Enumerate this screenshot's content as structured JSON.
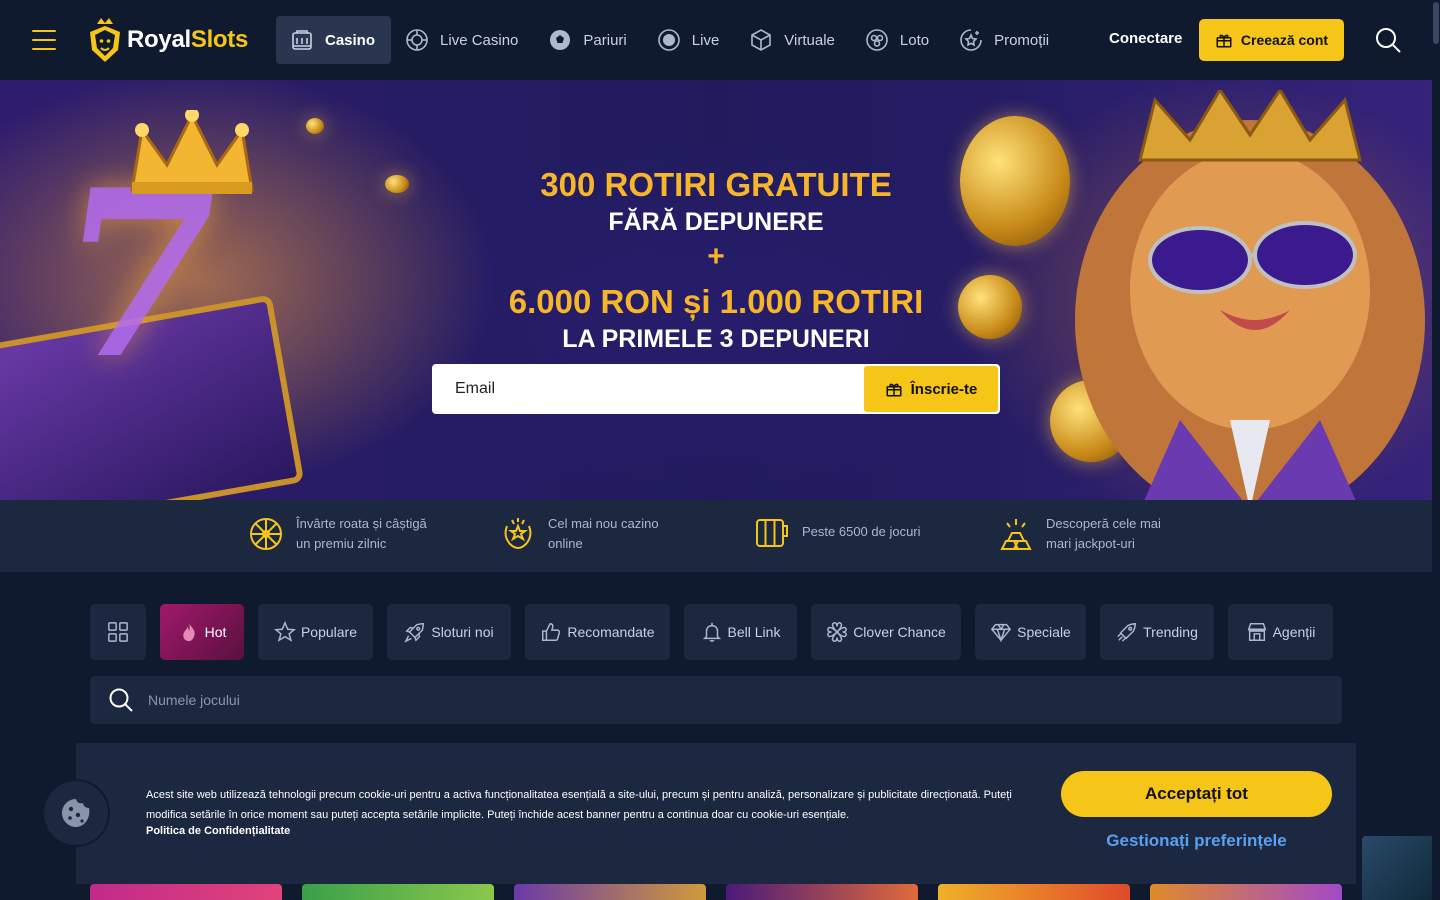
{
  "brand": {
    "name_part1": "Royal",
    "name_part2": "Slots",
    "accent": "#f5c518"
  },
  "nav": [
    {
      "label": "Casino",
      "icon": "slot-machine-icon",
      "active": true
    },
    {
      "label": "Live Casino",
      "icon": "roulette-icon"
    },
    {
      "label": "Pariuri",
      "icon": "football-icon"
    },
    {
      "label": "Live",
      "icon": "live-dot-icon"
    },
    {
      "label": "Virtuale",
      "icon": "cube-icon"
    },
    {
      "label": "Loto",
      "icon": "lottery-icon"
    },
    {
      "label": "Promoții",
      "icon": "promo-star-icon"
    }
  ],
  "header": {
    "login": "Conectare",
    "create_account": "Creează cont"
  },
  "hero": {
    "line1": "300 ROTIRI GRATUITE",
    "line2": "FĂRĂ DEPUNERE",
    "plus": "+",
    "line3": "6.000 RON și 1.000 ROTIRI",
    "line4": "LA PRIMELE 3 DEPUNERI",
    "email_placeholder": "Email",
    "signup_button": "Înscrie-te"
  },
  "features": [
    {
      "icon": "wheel-icon",
      "line1": "Învârte roata și câștigă",
      "line2": "un premiu zilnic"
    },
    {
      "icon": "laurel-star-icon",
      "line1": "Cel mai nou cazino",
      "line2": "online"
    },
    {
      "icon": "reels-icon",
      "line1": "Peste 6500 de jocuri",
      "line2": ""
    },
    {
      "icon": "gold-bars-icon",
      "line1": "Descoperă cele mai",
      "line2": "mari jackpot-uri"
    }
  ],
  "categories": [
    {
      "label": "",
      "icon": "grid-icon"
    },
    {
      "label": "Hot",
      "icon": "flame-icon"
    },
    {
      "label": "Populare",
      "icon": "star-icon"
    },
    {
      "label": "Sloturi noi",
      "icon": "rocket-icon"
    },
    {
      "label": "Recomandate",
      "icon": "thumbs-up-icon"
    },
    {
      "label": "Bell Link",
      "icon": "bell-icon"
    },
    {
      "label": "Clover Chance",
      "icon": "clover-icon"
    },
    {
      "label": "Speciale",
      "icon": "diamond-icon"
    },
    {
      "label": "Trending",
      "icon": "trending-rocket-icon"
    },
    {
      "label": "Agenții",
      "icon": "shop-icon"
    }
  ],
  "game_search": {
    "placeholder": "Numele jocului"
  },
  "cookie": {
    "text": "Acest site web utilizează tehnologii precum cookie-uri pentru a activa funcționalitatea esențială a site-ului, precum și pentru analiză, personalizare și publicitate direcționată. Puteți modifica setările în orice moment sau puteți accepta setările implicite. Puteți închide acest banner pentru a continua doar cu cookie-uri esențiale.",
    "policy": "Politica de Confidențialitate",
    "accept": "Acceptați tot",
    "manage": "Gestionați preferințele"
  }
}
